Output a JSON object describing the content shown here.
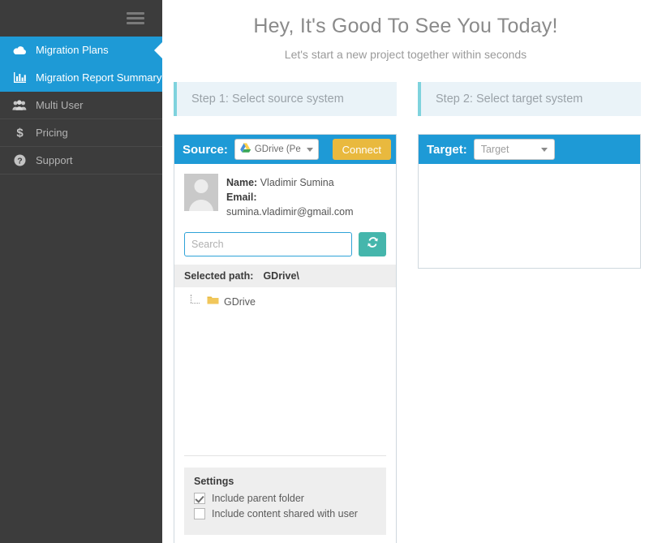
{
  "sidebar": {
    "menu_icon": "hamburger-icon",
    "items": [
      {
        "label": "Migration Plans",
        "icon": "cloud-icon",
        "active": true
      },
      {
        "label": "Migration Report Summary",
        "icon": "bar-chart-icon",
        "active": true
      },
      {
        "label": "Multi User",
        "icon": "users-icon",
        "active": false
      },
      {
        "label": "Pricing",
        "icon": "dollar-icon",
        "active": false
      },
      {
        "label": "Support",
        "icon": "question-circle-icon",
        "active": false
      }
    ]
  },
  "header": {
    "title": "Hey, It's Good To See You Today!",
    "subtitle": "Let's start a new project together within seconds"
  },
  "steps": {
    "step1": "Step 1: Select source system",
    "step2": "Step 2: Select target system"
  },
  "source": {
    "label": "Source:",
    "dropdown_value": "GDrive (Pe",
    "dropdown_icon": "google-drive-icon",
    "connect_label": "Connect",
    "user": {
      "name_label": "Name:",
      "name_value": "Vladimir Sumina",
      "email_label": "Email:",
      "email_value": "sumina.vladimir@gmail.com",
      "avatar_icon": "user-avatar-icon"
    },
    "search_placeholder": "Search",
    "search_value": "",
    "refresh_icon": "refresh-icon",
    "selected_path_label": "Selected path:",
    "selected_path_value": "GDrive\\",
    "tree": [
      {
        "label": "GDrive",
        "icon": "folder-icon"
      }
    ],
    "settings": {
      "title": "Settings",
      "options": [
        {
          "label": "Include parent folder",
          "checked": true
        },
        {
          "label": "Include content shared with user",
          "checked": false
        }
      ]
    }
  },
  "target": {
    "label": "Target:",
    "dropdown_value": "Target"
  },
  "colors": {
    "sidebar_bg": "#3c3c3c",
    "accent_blue": "#1e9ad6",
    "step_accent": "#7fd3dd",
    "connect_gold": "#e9b93e",
    "refresh_teal": "#45b6ac"
  }
}
